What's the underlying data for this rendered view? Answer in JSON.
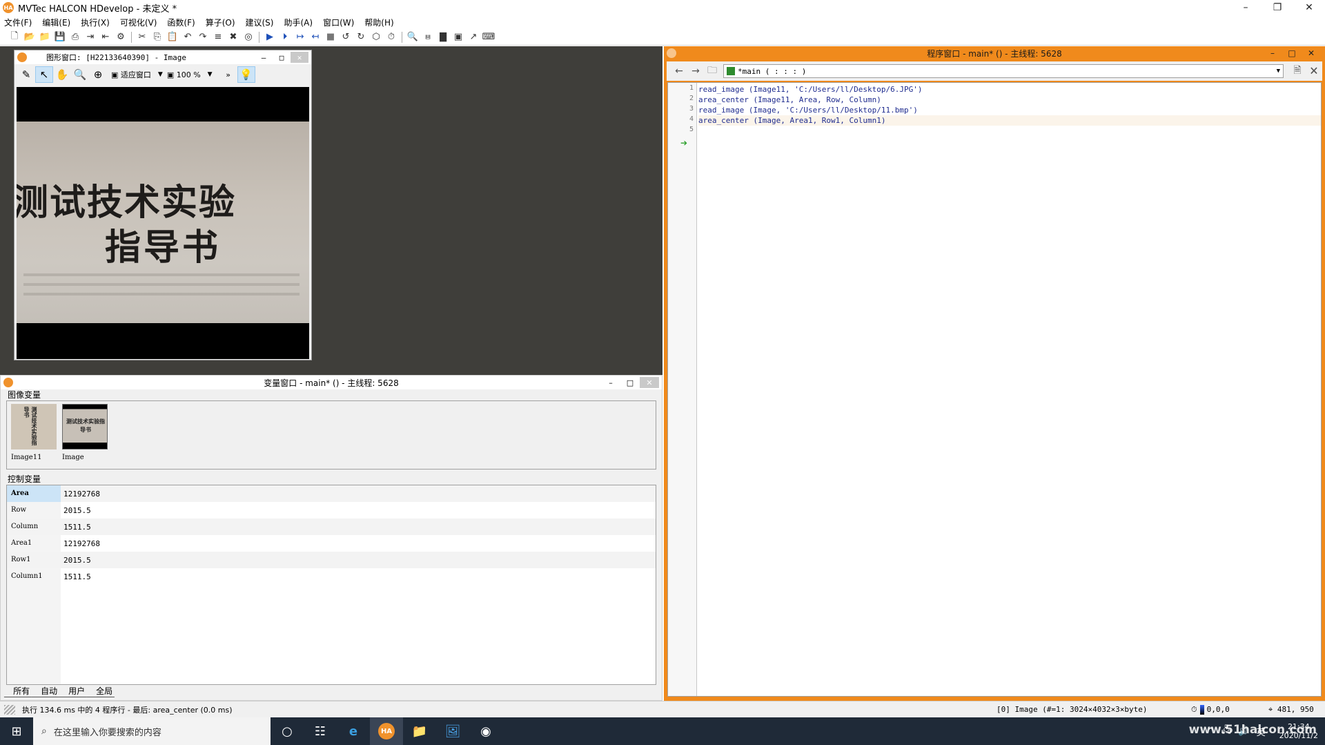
{
  "window": {
    "title": "MVTec HALCON HDevelop - 未定义 *",
    "app_icon": "HA"
  },
  "menu": [
    "文件(F)",
    "编辑(E)",
    "执行(X)",
    "可视化(V)",
    "函数(F)",
    "算子(O)",
    "建议(S)",
    "助手(A)",
    "窗口(W)",
    "帮助(H)"
  ],
  "graphics_window": {
    "title": "图形窗口: [H22133640390] - Image",
    "fit_label": "适应窗口",
    "zoom": "100 %",
    "image_text_line1": "测试技术实验",
    "image_text_line2": "指导书"
  },
  "variable_window": {
    "title": "变量窗口 - main* () - 主线程: 5628",
    "iconic_label": "图像变量",
    "control_label": "控制变量",
    "images": [
      {
        "name": "Image11",
        "thumb_text": "测试技术实验指导书"
      },
      {
        "name": "Image",
        "thumb_text": "测试技术实验指导书"
      }
    ],
    "controls": [
      {
        "name": "Area",
        "value": "12192768"
      },
      {
        "name": "Row",
        "value": "2015.5"
      },
      {
        "name": "Column",
        "value": "1511.5"
      },
      {
        "name": "Area1",
        "value": "12192768"
      },
      {
        "name": "Row1",
        "value": "2015.5"
      },
      {
        "name": "Column1",
        "value": "1511.5"
      }
    ],
    "tabs": [
      "所有",
      "自动",
      "用户",
      "全局"
    ]
  },
  "program_window": {
    "title": "程序窗口 - main* () - 主线程: 5628",
    "procedure": "*main ( : : : )",
    "line_numbers": [
      "1",
      "2",
      "3",
      "4",
      "5"
    ],
    "code": [
      "read_image (Image11, 'C:/Users/ll/Desktop/6.JPG')",
      "area_center (Image11, Area, Row, Column)",
      "read_image (Image, 'C:/Users/ll/Desktop/11.bmp')",
      "area_center (Image, Area1, Row1, Column1)"
    ]
  },
  "status": {
    "exec": "执行 134.6 ms 中的 4 程序行 - 最后: area_center (0.0 ms)",
    "image_info": "[0] Image (#=1: 3024×4032×3×byte)",
    "gray": "0,0,0",
    "position": "481, 950"
  },
  "taskbar": {
    "search_placeholder": "在这里输入你要搜索的内容",
    "time": "21:34",
    "date": "2020/11/2",
    "watermark": "www.51halcon.com"
  }
}
